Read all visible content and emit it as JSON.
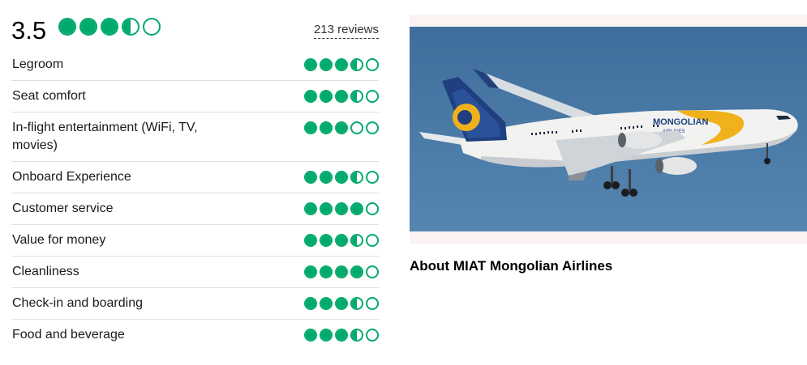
{
  "overall": {
    "score": "3.5",
    "rating": 3.5,
    "reviews": "213 reviews"
  },
  "categories": [
    {
      "label": "Legroom",
      "rating": 3.5
    },
    {
      "label": "Seat comfort",
      "rating": 3.5
    },
    {
      "label": "In-flight entertainment (WiFi, TV, movies)",
      "rating": 3
    },
    {
      "label": "Onboard Experience",
      "rating": 3.5
    },
    {
      "label": "Customer service",
      "rating": 4
    },
    {
      "label": "Value for money",
      "rating": 3.5
    },
    {
      "label": "Cleanliness",
      "rating": 4
    },
    {
      "label": "Check-in and boarding",
      "rating": 3.5
    },
    {
      "label": "Food and beverage",
      "rating": 3.5
    }
  ],
  "about": {
    "title": "About MIAT Mongolian Airlines",
    "photo_fuselage_text": "MONGOLIAN",
    "photo_airlines_text": "AIRLINES"
  },
  "colors": {
    "bubble_green": "#00aa6c",
    "sky_blue": "#4b7aa6",
    "photo_frame_bg": "#fbf3f1"
  }
}
